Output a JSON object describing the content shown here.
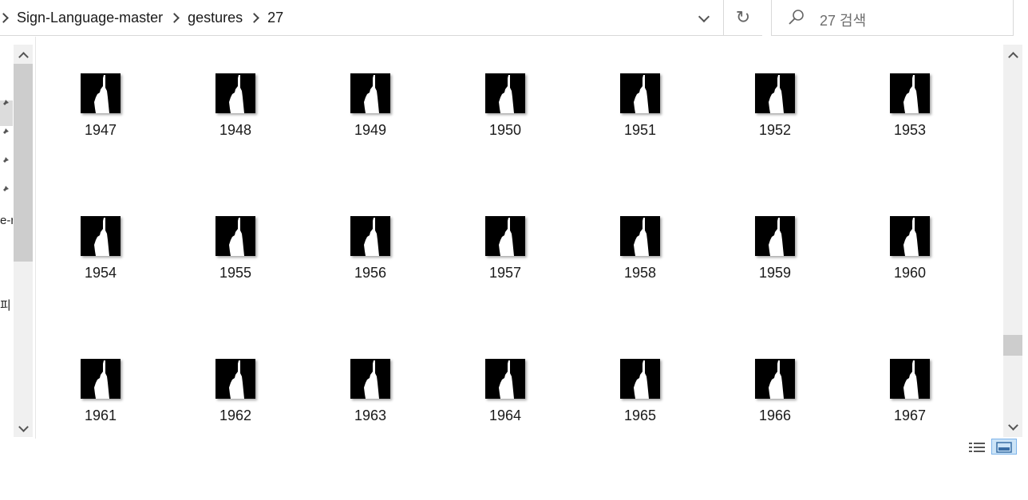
{
  "address": {
    "crumbs": [
      "Sign-Language-master",
      "gestures",
      "27"
    ],
    "icons": {
      "dropdown": "chevron-down-icon",
      "refresh": "refresh-icon"
    }
  },
  "search": {
    "placeholder": "27 검색",
    "icon": "search-icon"
  },
  "navpane": {
    "fragments": [
      "e-r",
      "피"
    ],
    "pin_icon": "pin-icon"
  },
  "files": {
    "rows": [
      [
        "1947",
        "1948",
        "1949",
        "1950",
        "1951",
        "1952",
        "1953"
      ],
      [
        "1954",
        "1955",
        "1956",
        "1957",
        "1958",
        "1959",
        "1960"
      ],
      [
        "1961",
        "1962",
        "1963",
        "1964",
        "1965",
        "1966",
        "1967"
      ]
    ],
    "thumb_colors": {
      "bg": "#000000",
      "hand": "#ffffff"
    }
  },
  "statusbar": {
    "view_buttons": [
      "details-view-icon",
      "large-icons-view-icon"
    ],
    "active_view_color": "#cce4f7"
  }
}
